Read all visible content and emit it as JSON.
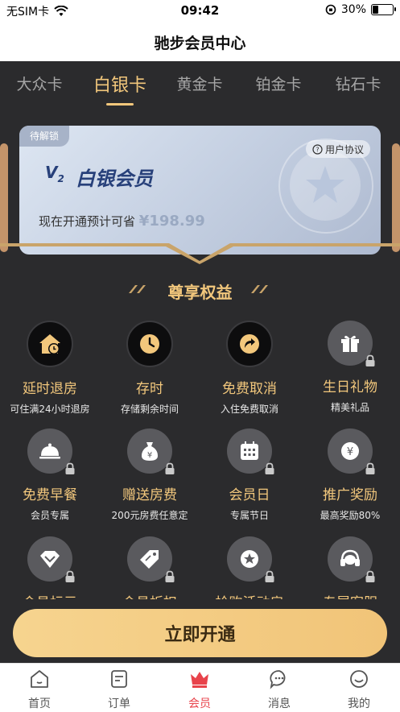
{
  "status": {
    "carrier": "无SIM卡",
    "time": "09:42",
    "battery": "30%"
  },
  "nav": {
    "title": "驰步会员中心"
  },
  "tabs": [
    "大众卡",
    "白银卡",
    "黄金卡",
    "铂金卡",
    "钻石卡"
  ],
  "card": {
    "tag": "待解锁",
    "agreement": "用户协议",
    "logo_letter": "V",
    "logo_sub": "2",
    "name": "白银会员",
    "save_text": "现在开通预计可省",
    "currency": "¥",
    "amount": "198.99"
  },
  "benefits": {
    "title": "尊享权益",
    "items": [
      {
        "label": "延时退房",
        "sub": "可住满24小时退房",
        "icon": "house-clock-icon",
        "locked": false
      },
      {
        "label": "存时",
        "sub": "存储剩余时间",
        "icon": "clock-icon",
        "locked": false
      },
      {
        "label": "免费取消",
        "sub": "入住免费取消",
        "icon": "refresh-arrow-icon",
        "locked": false
      },
      {
        "label": "生日礼物",
        "sub": "精美礼品",
        "icon": "gift-icon",
        "locked": true
      },
      {
        "label": "免费早餐",
        "sub": "会员专属",
        "icon": "cloche-icon",
        "locked": true
      },
      {
        "label": "赠送房费",
        "sub": "200元房费任意定",
        "icon": "money-bag-icon",
        "locked": true
      },
      {
        "label": "会员日",
        "sub": "专属节日",
        "icon": "calendar-icon",
        "locked": true
      },
      {
        "label": "推广奖励",
        "sub": "最高奖励80%",
        "icon": "yen-coin-icon",
        "locked": true
      },
      {
        "label": "会员标示",
        "sub": "",
        "icon": "badge-icon",
        "locked": true
      },
      {
        "label": "会员折扣",
        "sub": "",
        "icon": "tag-icon",
        "locked": true
      },
      {
        "label": "抢购活动房",
        "sub": "",
        "icon": "star-badge-icon",
        "locked": true
      },
      {
        "label": "专属客服",
        "sub": "",
        "icon": "headset-icon",
        "locked": true
      }
    ]
  },
  "cta": {
    "label": "立即开通"
  },
  "tabbar": [
    {
      "label": "首页",
      "icon": "home-icon",
      "active": false
    },
    {
      "label": "订单",
      "icon": "order-icon",
      "active": false
    },
    {
      "label": "会员",
      "icon": "crown-icon",
      "active": true
    },
    {
      "label": "消息",
      "icon": "message-icon",
      "active": false
    },
    {
      "label": "我的",
      "icon": "profile-icon",
      "active": false
    }
  ],
  "colors": {
    "gold": "#f2c77c",
    "background": "#2b2b2d",
    "active_tab": "#e8434b"
  }
}
